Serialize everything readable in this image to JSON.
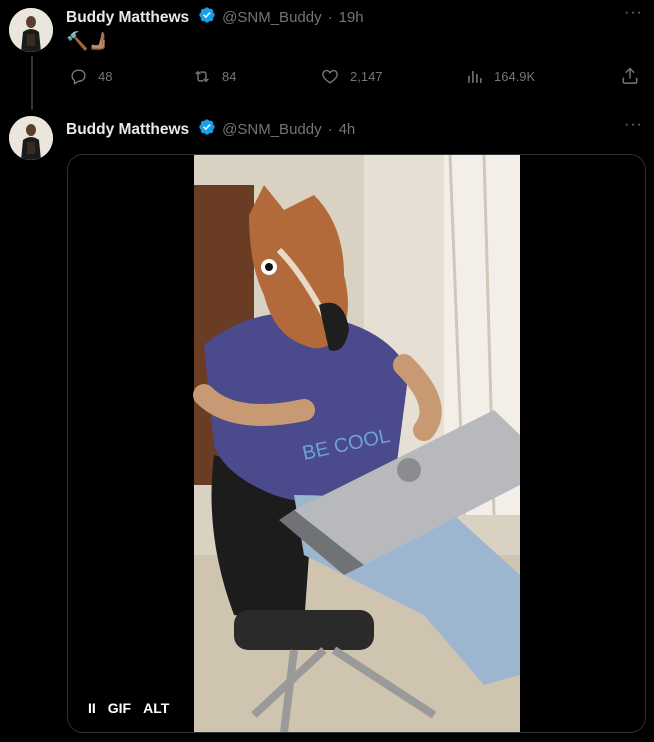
{
  "tweets": [
    {
      "author_name": "Buddy Matthews",
      "handle": "@SNM_Buddy",
      "time": "19h",
      "text": "🔨🫸🏽",
      "stats": {
        "replies": "48",
        "retweets": "84",
        "likes": "2,147",
        "views": "164.9K"
      }
    },
    {
      "author_name": "Buddy Matthews",
      "handle": "@SNM_Buddy",
      "time": "4h",
      "media": {
        "pause_label": "II",
        "gif_label": "GIF",
        "alt_label": "ALT",
        "shirt_text": "BE COOL"
      }
    }
  ],
  "colors": {
    "background": "#000000",
    "text_primary": "#e7e9ea",
    "text_secondary": "#71767b",
    "verified_blue": "#1d9bf0",
    "divider": "#2f3336"
  }
}
